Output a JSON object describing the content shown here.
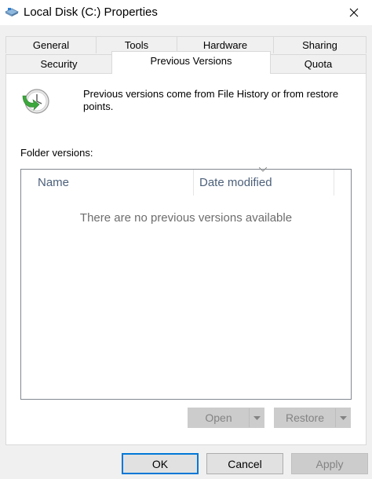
{
  "window": {
    "title": "Local Disk (C:) Properties"
  },
  "tabs_back": [
    {
      "label": "General"
    },
    {
      "label": "Tools"
    },
    {
      "label": "Hardware"
    },
    {
      "label": "Sharing"
    }
  ],
  "tabs_front": [
    {
      "label": "Security"
    },
    {
      "label": "Previous Versions"
    },
    {
      "label": "Quota"
    }
  ],
  "active_tab": "Previous Versions",
  "panel": {
    "info_text": "Previous versions come from File History or from restore points.",
    "folder_label": "Folder versions:",
    "columns": [
      {
        "label": "Name"
      },
      {
        "label": "Date modified"
      }
    ],
    "empty_message": "There are no previous versions available",
    "open_label": "Open",
    "restore_label": "Restore"
  },
  "buttons": {
    "ok": "OK",
    "cancel": "Cancel",
    "apply": "Apply"
  },
  "colors": {
    "accent": "#0078d7",
    "header_text": "#4c607a",
    "clock_green": "#3ca83c"
  }
}
